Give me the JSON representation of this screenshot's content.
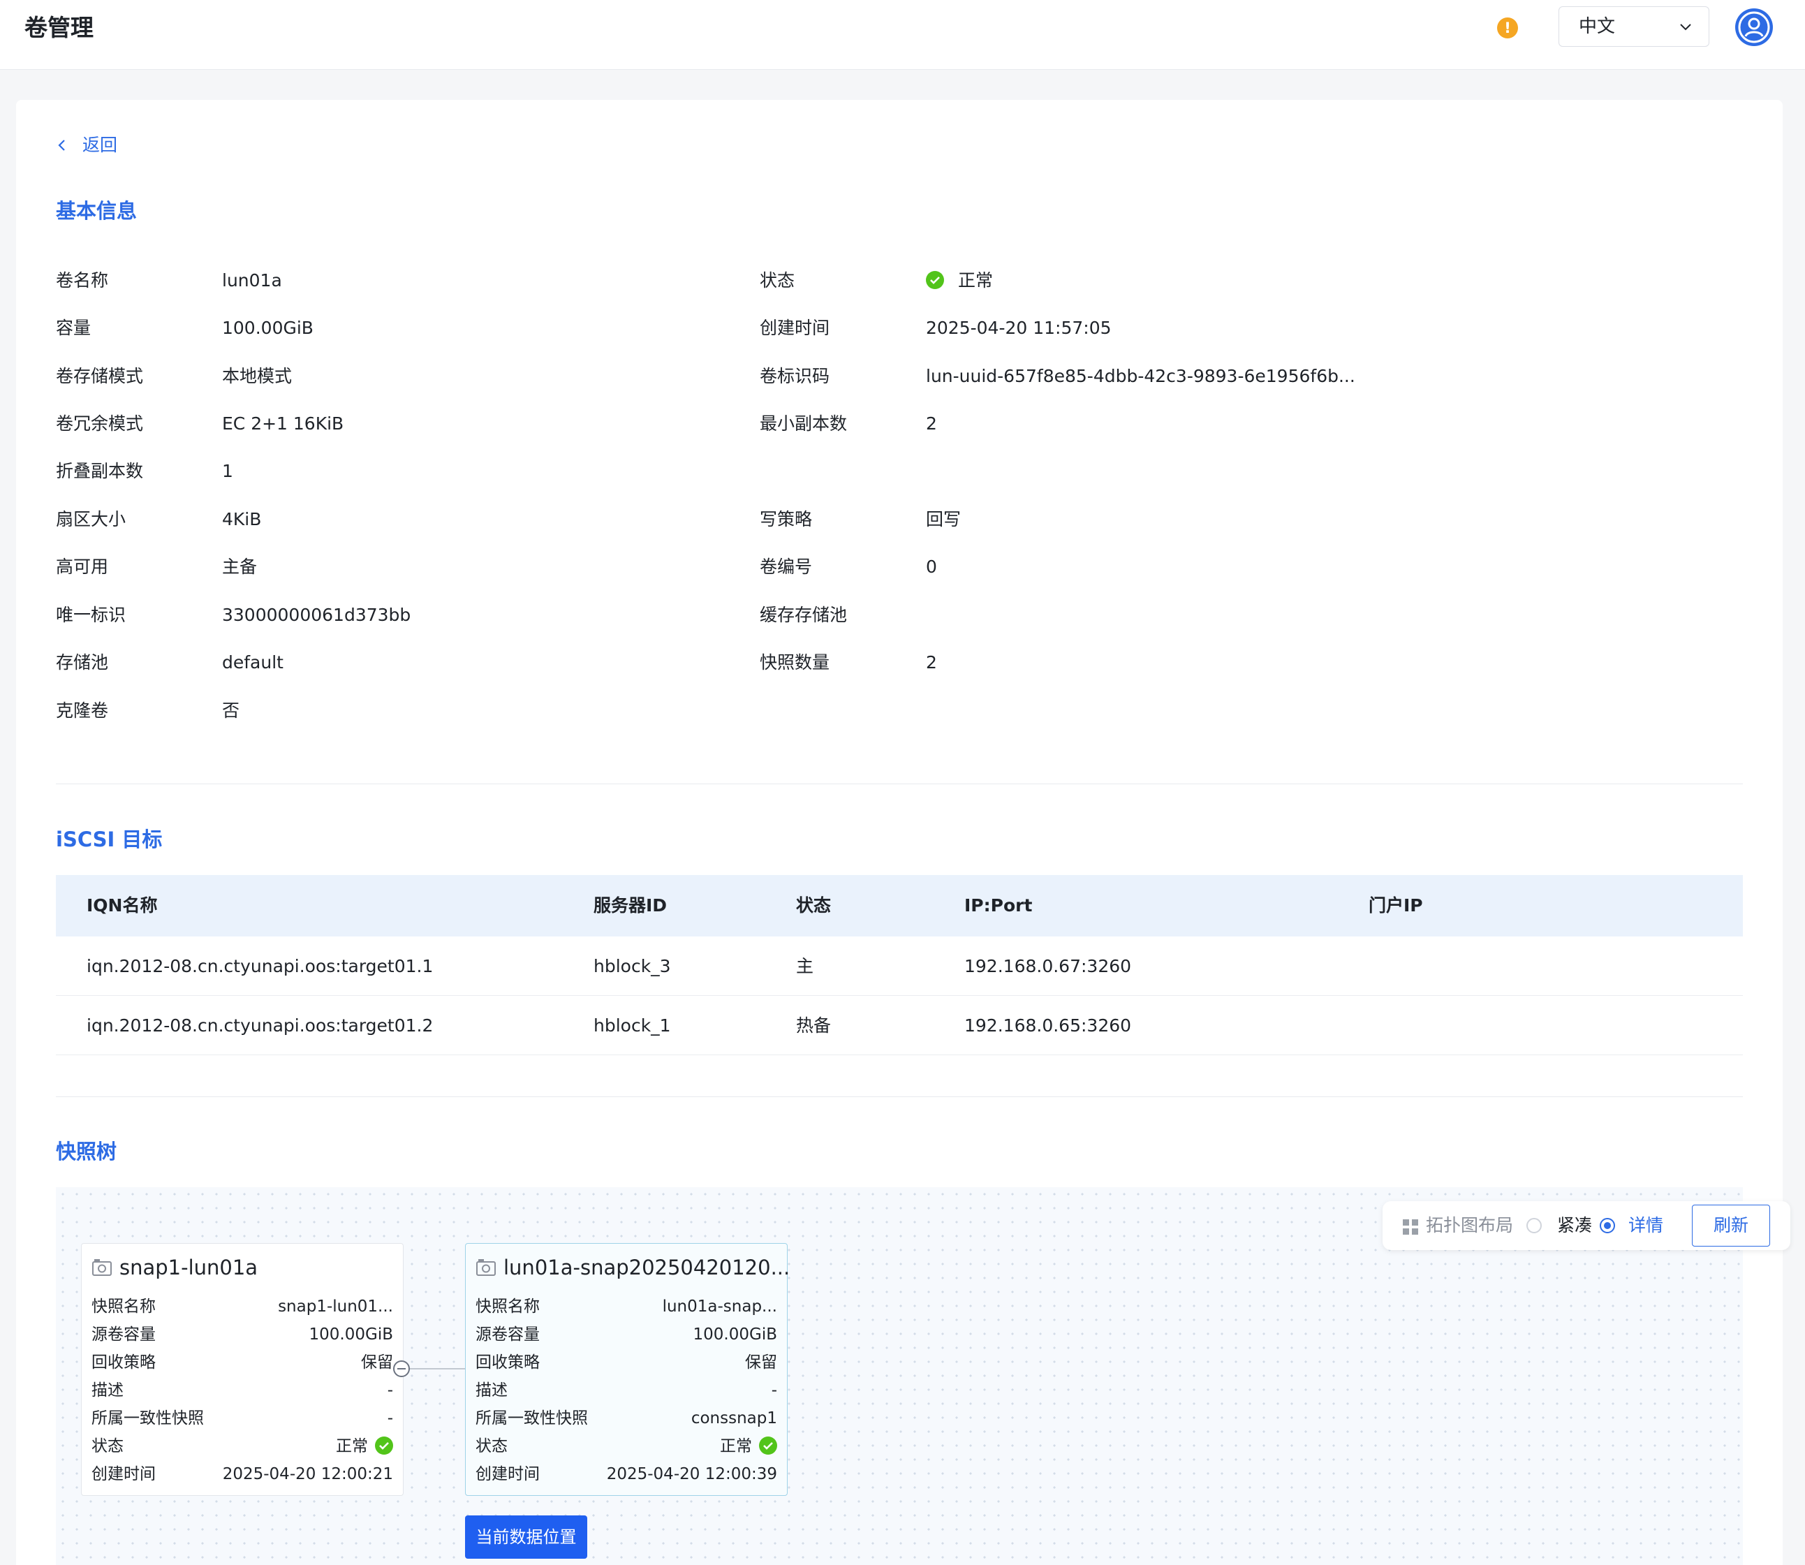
{
  "app": {
    "title": "卷管理"
  },
  "header": {
    "alert_icon": "exclamation-icon",
    "language": "中文",
    "avatar_icon": "user-icon"
  },
  "colors": {
    "accent": "#2d6be4",
    "status_ok": "#52c41a",
    "alert": "#f5a623",
    "header_bg": "#eaf2fc"
  },
  "nav": {
    "back_label": "返回"
  },
  "basic_info": {
    "title": "基本信息",
    "left": [
      {
        "label": "卷名称",
        "value": "lun01a"
      },
      {
        "label": "容量",
        "value": "100.00GiB"
      },
      {
        "label": "卷存储模式",
        "value": "本地模式"
      },
      {
        "label": "卷冗余模式",
        "value": "EC 2+1 16KiB"
      },
      {
        "label": "折叠副本数",
        "value": "1"
      },
      {
        "label": "扇区大小",
        "value": "4KiB"
      },
      {
        "label": "高可用",
        "value": "主备"
      },
      {
        "label": "唯一标识",
        "value": "33000000061d373bb"
      },
      {
        "label": "存储池",
        "value": "default"
      },
      {
        "label": "克隆卷",
        "value": "否"
      }
    ],
    "right": [
      {
        "label": "状态",
        "value": "正常"
      },
      {
        "label": "创建时间",
        "value": "2025-04-20 11:57:05"
      },
      {
        "label": "卷标识码",
        "value": "lun-uuid-657f8e85-4dbb-42c3-9893-6e1956f6b..."
      },
      {
        "label": "最小副本数",
        "value": "2"
      },
      {
        "label": "写策略",
        "value": "回写"
      },
      {
        "label": "卷编号",
        "value": "0"
      },
      {
        "label": "缓存存储池",
        "value": ""
      },
      {
        "label": "快照数量",
        "value": "2"
      }
    ]
  },
  "iscsi": {
    "title": "iSCSI 目标",
    "columns": [
      "IQN名称",
      "服务器ID",
      "状态",
      "IP:Port",
      "门户IP"
    ],
    "rows": [
      [
        "iqn.2012-08.cn.ctyunapi.oos:target01.1",
        "hblock_3",
        "主",
        "192.168.0.67:3260",
        ""
      ],
      [
        "iqn.2012-08.cn.ctyunapi.oos:target01.2",
        "hblock_1",
        "热备",
        "192.168.0.65:3260",
        ""
      ]
    ]
  },
  "snapshot_tree": {
    "title": "快照树",
    "toolbar": {
      "layout_label": "拓扑图布局",
      "compact_label": "紧凑",
      "detail_label": "详情",
      "selected": "详情",
      "refresh_label": "刷新"
    },
    "current_position_label": "当前数据位置",
    "nodes": [
      {
        "title": "snap1-lun01a",
        "rows": [
          {
            "k": "快照名称",
            "v": "snap1-lun01..."
          },
          {
            "k": "源卷容量",
            "v": "100.00GiB"
          },
          {
            "k": "回收策略",
            "v": "保留"
          },
          {
            "k": "描述",
            "v": "-"
          },
          {
            "k": "所属一致性快照",
            "v": "-"
          },
          {
            "k": "状态",
            "v": "正常"
          },
          {
            "k": "创建时间",
            "v": "2025-04-20 12:00:21"
          }
        ]
      },
      {
        "title": "lun01a-snap20250420120...",
        "rows": [
          {
            "k": "快照名称",
            "v": "lun01a-snap..."
          },
          {
            "k": "源卷容量",
            "v": "100.00GiB"
          },
          {
            "k": "回收策略",
            "v": "保留"
          },
          {
            "k": "描述",
            "v": "-"
          },
          {
            "k": "所属一致性快照",
            "v": "conssnap1"
          },
          {
            "k": "状态",
            "v": "正常"
          },
          {
            "k": "创建时间",
            "v": "2025-04-20 12:00:39"
          }
        ]
      }
    ]
  }
}
